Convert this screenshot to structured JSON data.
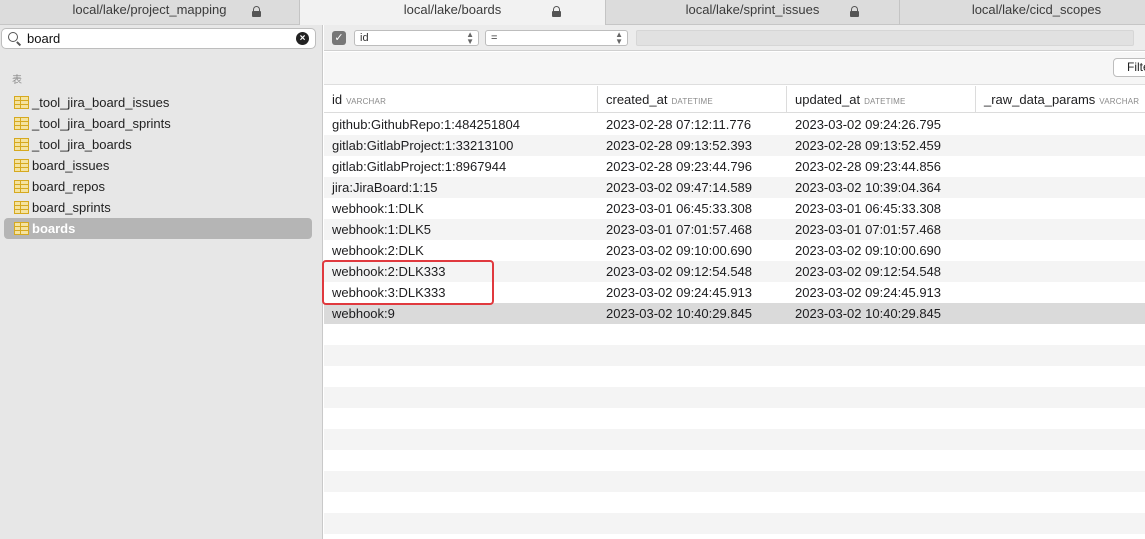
{
  "tabs": [
    {
      "label": "local/lake/project_mapping",
      "active": false
    },
    {
      "label": "local/lake/boards",
      "active": true
    },
    {
      "label": "local/lake/sprint_issues",
      "active": false
    },
    {
      "label": "local/lake/cicd_scopes",
      "active": false
    }
  ],
  "sidebar": {
    "search_value": "board",
    "section_label": "表",
    "items": [
      {
        "label": "_tool_jira_board_issues",
        "selected": false
      },
      {
        "label": "_tool_jira_board_sprints",
        "selected": false
      },
      {
        "label": "_tool_jira_boards",
        "selected": false
      },
      {
        "label": "board_issues",
        "selected": false
      },
      {
        "label": "board_repos",
        "selected": false
      },
      {
        "label": "board_sprints",
        "selected": false
      },
      {
        "label": "boards",
        "selected": true
      }
    ]
  },
  "filter": {
    "enabled": true,
    "column": "id",
    "operator": "=",
    "value": ""
  },
  "toolbar": {
    "filter_button_label": "Filter"
  },
  "table": {
    "columns": [
      {
        "name": "id",
        "type": "VARCHAR"
      },
      {
        "name": "created_at",
        "type": "DATETIME"
      },
      {
        "name": "updated_at",
        "type": "DATETIME"
      },
      {
        "name": "_raw_data_params",
        "type": "VARCHAR"
      }
    ],
    "rows": [
      [
        "github:GithubRepo:1:484251804",
        "2023-02-28 07:12:11.776",
        "2023-03-02 09:24:26.795",
        ""
      ],
      [
        "gitlab:GitlabProject:1:33213100",
        "2023-02-28 09:13:52.393",
        "2023-02-28 09:13:52.459",
        ""
      ],
      [
        "gitlab:GitlabProject:1:8967944",
        "2023-02-28 09:23:44.796",
        "2023-02-28 09:23:44.856",
        ""
      ],
      [
        "jira:JiraBoard:1:15",
        "2023-03-02 09:47:14.589",
        "2023-03-02 10:39:04.364",
        ""
      ],
      [
        "webhook:1:DLK",
        "2023-03-01 06:45:33.308",
        "2023-03-01 06:45:33.308",
        ""
      ],
      [
        "webhook:1:DLK5",
        "2023-03-01 07:01:57.468",
        "2023-03-01 07:01:57.468",
        ""
      ],
      [
        "webhook:2:DLK",
        "2023-03-02 09:10:00.690",
        "2023-03-02 09:10:00.690",
        ""
      ],
      [
        "webhook:2:DLK333",
        "2023-03-02 09:12:54.548",
        "2023-03-02 09:12:54.548",
        ""
      ],
      [
        "webhook:3:DLK333",
        "2023-03-02 09:24:45.913",
        "2023-03-02 09:24:45.913",
        ""
      ],
      [
        "webhook:9",
        "2023-03-02 10:40:29.845",
        "2023-03-02 10:40:29.845",
        ""
      ]
    ],
    "selected_row": 9,
    "highlight_color": "#e0393e"
  }
}
